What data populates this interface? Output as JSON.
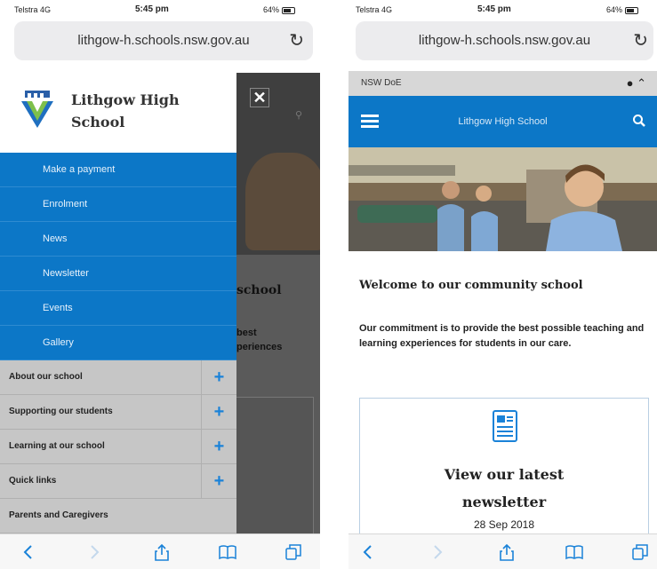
{
  "left_screen": {
    "status": {
      "carrier": "Telstra  4G",
      "time": "5:45 pm",
      "battery": "64%"
    },
    "url": "lithgow-h.schools.nsw.gov.au",
    "drawer": {
      "school_name_line1": "Lithgow High",
      "school_name_line2": "School",
      "primary_items": [
        "Make a payment",
        "Enrolment",
        "News",
        "Newsletter",
        "Events",
        "Gallery"
      ],
      "secondary_items": [
        {
          "label": "About our school",
          "expandable": true
        },
        {
          "label": "Supporting our students",
          "expandable": true
        },
        {
          "label": "Learning at our school",
          "expandable": true
        },
        {
          "label": "Quick links",
          "expandable": true
        },
        {
          "label": "Parents and Caregivers",
          "expandable": false
        }
      ],
      "close_icon": "✕"
    },
    "backdrop": {
      "title_fragment": "school",
      "text_line1": "best",
      "text_line2": "periences"
    }
  },
  "right_screen": {
    "status": {
      "carrier": "Telstra  4G",
      "time": "5:45 pm",
      "battery": "64%"
    },
    "url": "lithgow-h.schools.nsw.gov.au",
    "top_bar_label": "NSW DoE",
    "header_title": "Lithgow High School",
    "welcome_heading": "Welcome to our community school",
    "commitment_text": "Our commitment is to provide the best possible teaching and learning experiences for students in our care.",
    "card": {
      "title_line1": "View our latest",
      "title_line2": "newsletter",
      "date": "28 Sep 2018"
    }
  },
  "toolbar_icons": [
    "back-icon",
    "forward-icon",
    "share-icon",
    "bookmarks-icon",
    "tabs-icon"
  ],
  "colors": {
    "brand_blue": "#0c77c7",
    "grey_menu": "#c6c6c6",
    "link_blue": "#1a82d8"
  }
}
